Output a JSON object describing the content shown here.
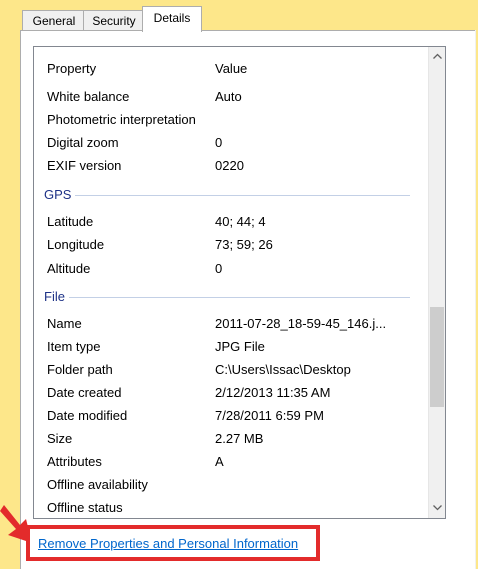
{
  "tabs": [
    {
      "label": "General"
    },
    {
      "label": "Security"
    },
    {
      "label": "Details"
    }
  ],
  "columns": {
    "property": "Property",
    "value": "Value"
  },
  "rows_top": [
    {
      "k": "White balance",
      "v": "Auto"
    },
    {
      "k": "Photometric interpretation",
      "v": ""
    },
    {
      "k": "Digital zoom",
      "v": "0"
    },
    {
      "k": "EXIF version",
      "v": "0220"
    }
  ],
  "group_gps": "GPS",
  "rows_gps": [
    {
      "k": "Latitude",
      "v": "40; 44; 4"
    },
    {
      "k": "Longitude",
      "v": "73; 59; 26"
    },
    {
      "k": "Altitude",
      "v": "0"
    }
  ],
  "group_file": "File",
  "rows_file": [
    {
      "k": "Name",
      "v": "2011-07-28_18-59-45_146.j..."
    },
    {
      "k": "Item type",
      "v": "JPG File"
    },
    {
      "k": "Folder path",
      "v": "C:\\Users\\Issac\\Desktop"
    },
    {
      "k": "Date created",
      "v": "2/12/2013 11:35 AM"
    },
    {
      "k": "Date modified",
      "v": "7/28/2011 6:59 PM"
    },
    {
      "k": "Size",
      "v": "2.27 MB"
    },
    {
      "k": "Attributes",
      "v": "A"
    },
    {
      "k": "Offline availability",
      "v": ""
    },
    {
      "k": "Offline status",
      "v": ""
    }
  ],
  "link": "Remove Properties and Personal Information",
  "scroll_position": 0.72,
  "colors": {
    "highlight": "#e32b2b",
    "link": "#0066cc",
    "background": "#fde78a"
  }
}
